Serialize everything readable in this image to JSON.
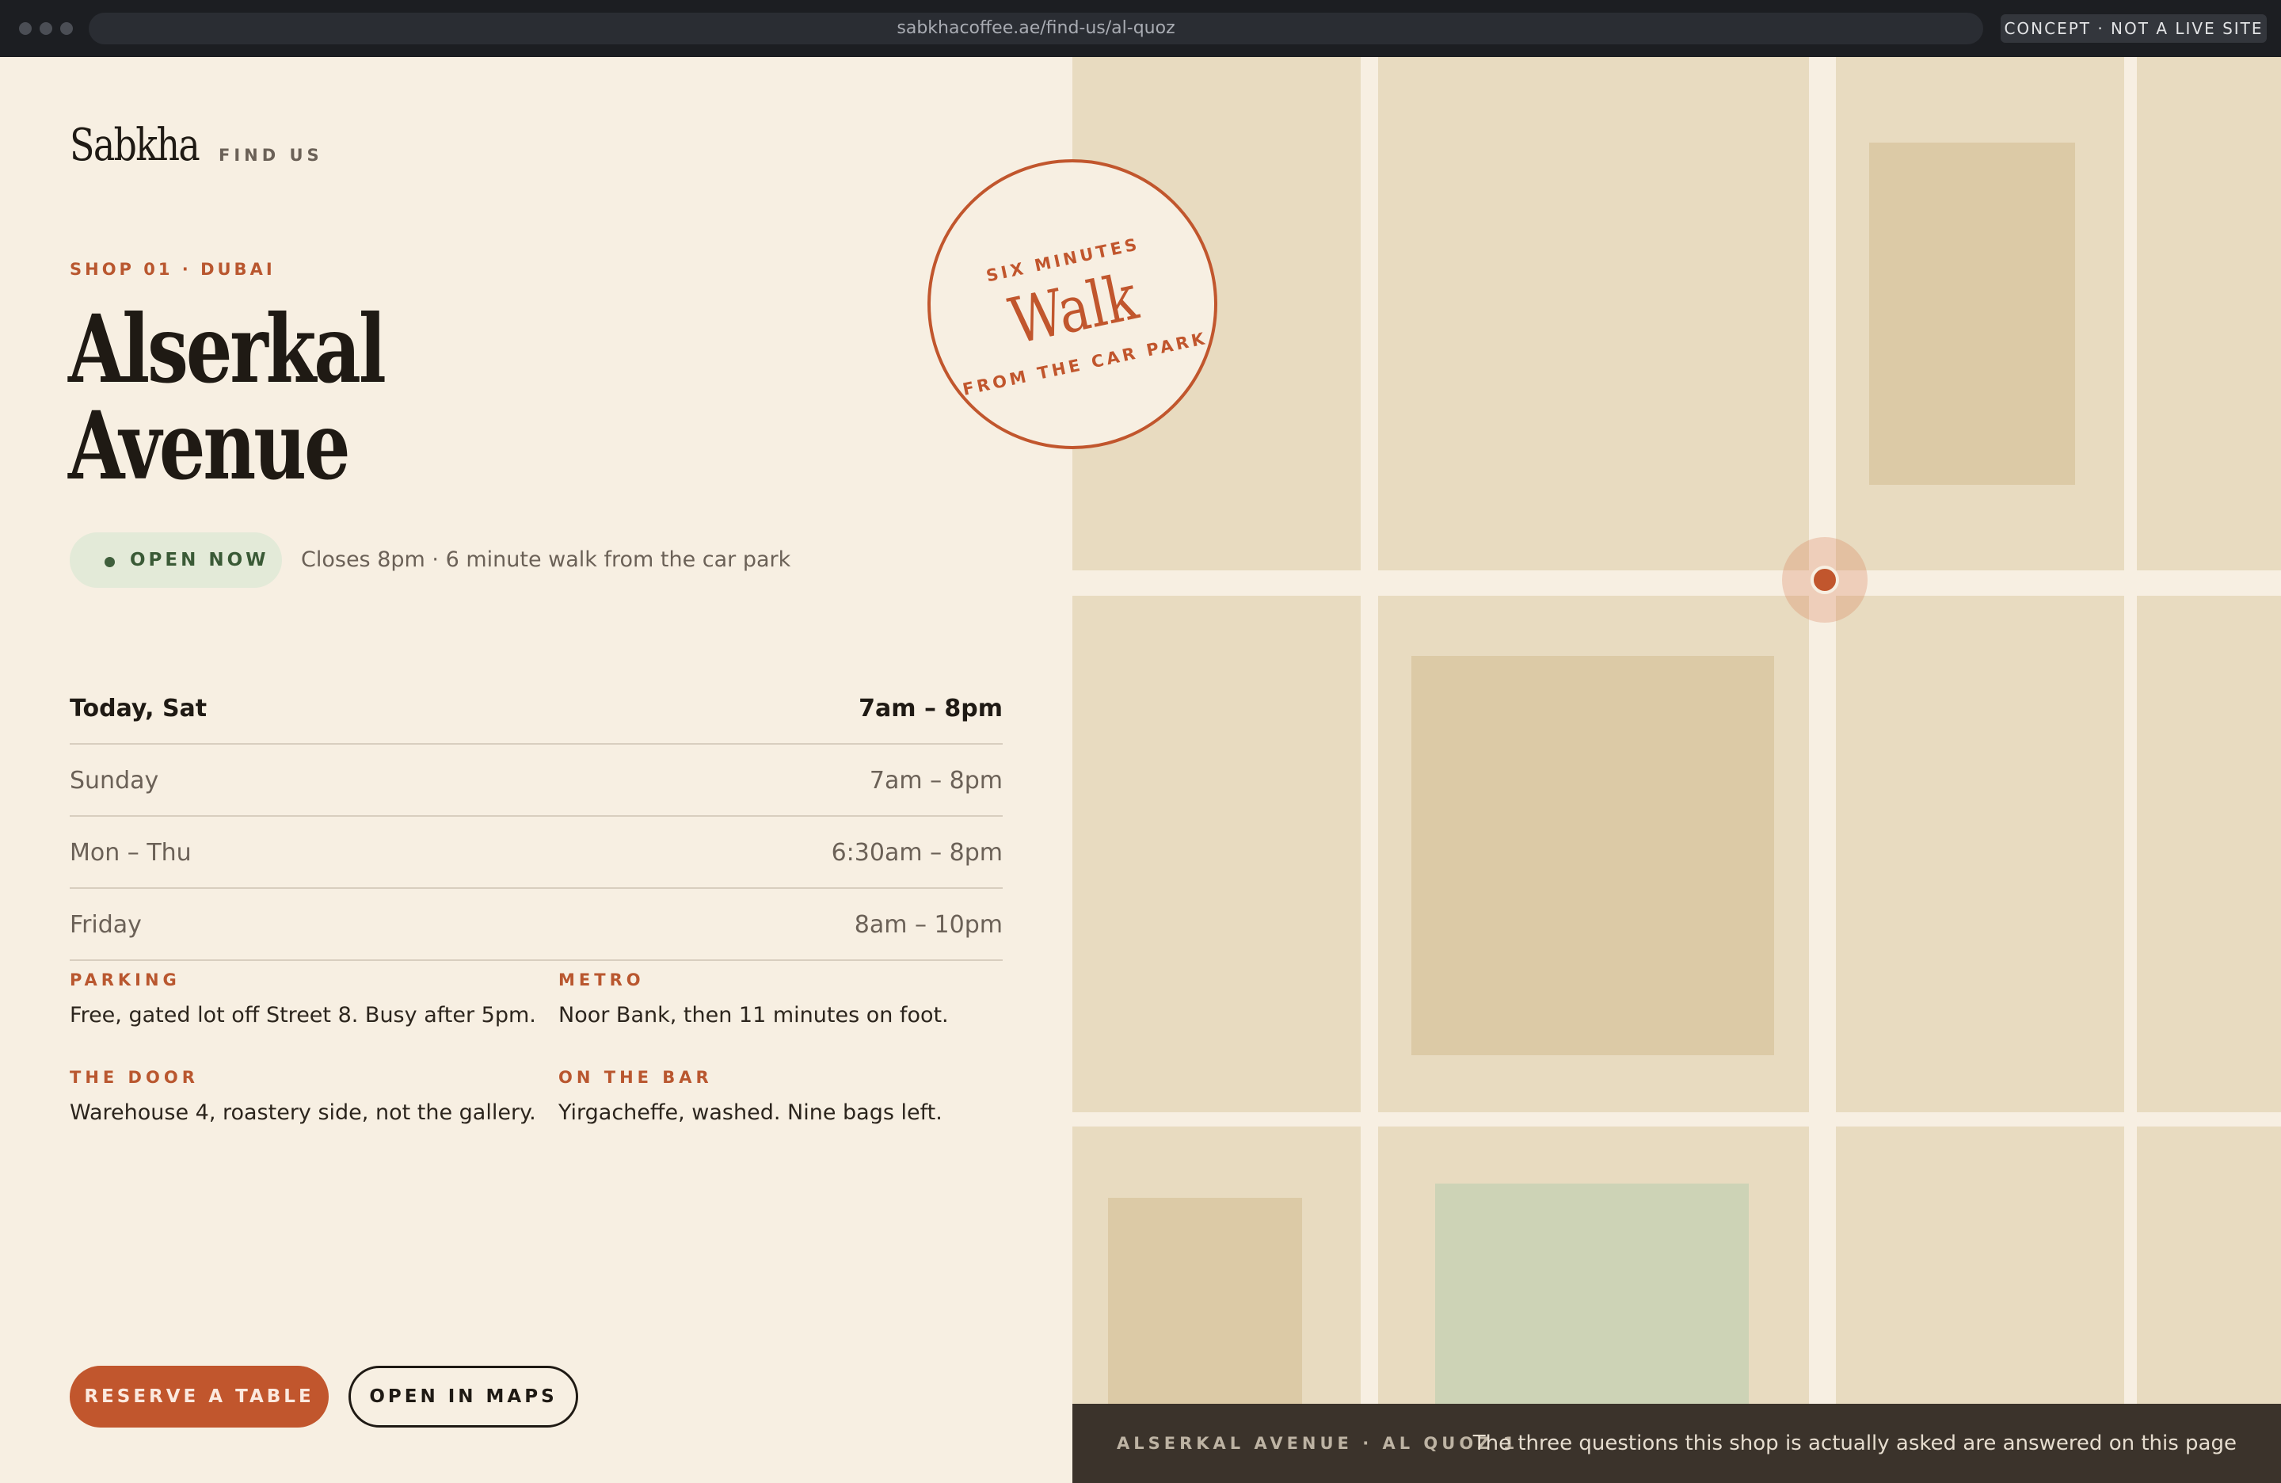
{
  "browser": {
    "url": "sabkhacoffee.ae/find-us/al-quoz",
    "badge": "CONCEPT · NOT A LIVE SITE"
  },
  "brand": {
    "name": "Sabkha",
    "section": "FIND US"
  },
  "shop": {
    "eyebrow": "SHOP 01 · DUBAI",
    "title_line1": "Alserkal",
    "title_line2": "Avenue"
  },
  "status": {
    "label": "OPEN NOW",
    "note": "Closes 8pm · 6 minute walk from the car park"
  },
  "hours": [
    {
      "day": "Today, Sat",
      "time": "7am – 8pm"
    },
    {
      "day": "Sunday",
      "time": "7am – 8pm"
    },
    {
      "day": "Mon – Thu",
      "time": "6:30am – 8pm"
    },
    {
      "day": "Friday",
      "time": "8am – 10pm"
    }
  ],
  "facts": {
    "parking": {
      "label": "PARKING",
      "text": "Free, gated lot off Street 8. Busy after 5pm."
    },
    "metro": {
      "label": "METRO",
      "text": "Noor Bank, then 11 minutes on foot."
    },
    "door": {
      "label": "THE DOOR",
      "text": "Warehouse 4, roastery side, not the gallery."
    },
    "bar": {
      "label": "ON THE BAR",
      "text": "Yirgacheffe, washed. Nine bags left."
    }
  },
  "actions": {
    "reserve": "RESERVE A TABLE",
    "maps": "OPEN IN MAPS"
  },
  "stamp": {
    "top": "SIX MINUTES",
    "main": "Walk",
    "bottom": "FROM THE CAR PARK"
  },
  "map": {
    "footer_left": "ALSERKAL AVENUE · AL QUOZ 1",
    "footer_right": "The three questions this shop is actually asked are answered on this page"
  },
  "colors": {
    "accent": "#c1562d",
    "background": "#f7efe2",
    "map_land": "#e8dbc0",
    "map_building": "#dccaa6",
    "map_park": "#cdd3b6",
    "open_green": "#3a5a36"
  }
}
